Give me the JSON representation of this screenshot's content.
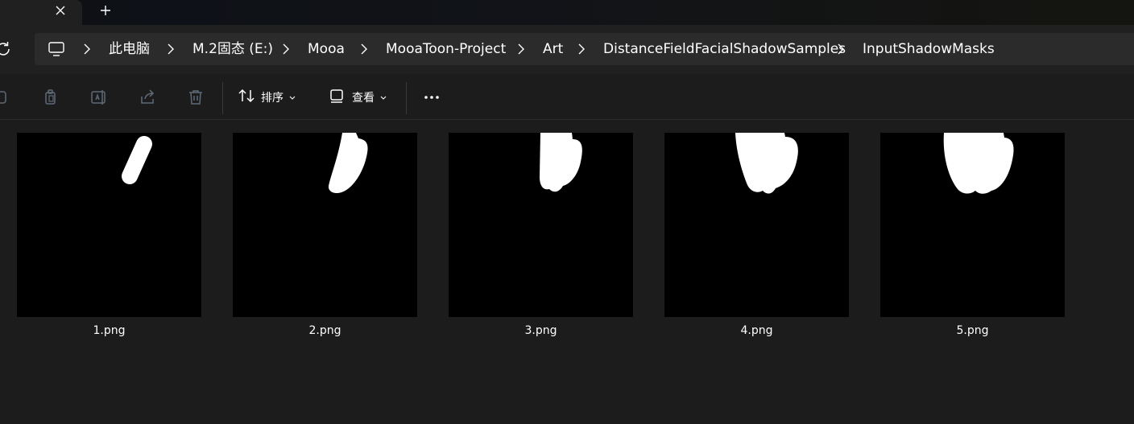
{
  "icons": {
    "tab_close": "close-icon",
    "new_tab": "plus-icon",
    "refresh": "refresh-icon",
    "this_pc": "monitor-icon",
    "breadcrumb_separator": "chevron-right-icon",
    "cut": "cut-icon",
    "copy": "copy-icon",
    "rename": "rename-icon",
    "share": "share-icon",
    "delete": "trash-icon",
    "sort": "sort-icon",
    "view": "view-icon",
    "more": "more-icon"
  },
  "breadcrumb": [
    "此电脑",
    "M.2固态 (E:)",
    "Mooa",
    "MooaToon-Project",
    "Art",
    "DistanceFieldFacialShadowSamples",
    "InputShadowMasks"
  ],
  "toolbar": {
    "sort_label": "排序",
    "view_label": "查看"
  },
  "files": [
    {
      "name": "1.png"
    },
    {
      "name": "2.png"
    },
    {
      "name": "3.png"
    },
    {
      "name": "4.png"
    },
    {
      "name": "5.png"
    }
  ],
  "colors": {
    "background": "#1c1c1c",
    "address_bar": "#2b2b2b",
    "toolbar_icon_disabled": "#5f6b78",
    "text": "#ffffff",
    "thumbnail_bg": "#000000",
    "mask_fill": "#ffffff"
  }
}
